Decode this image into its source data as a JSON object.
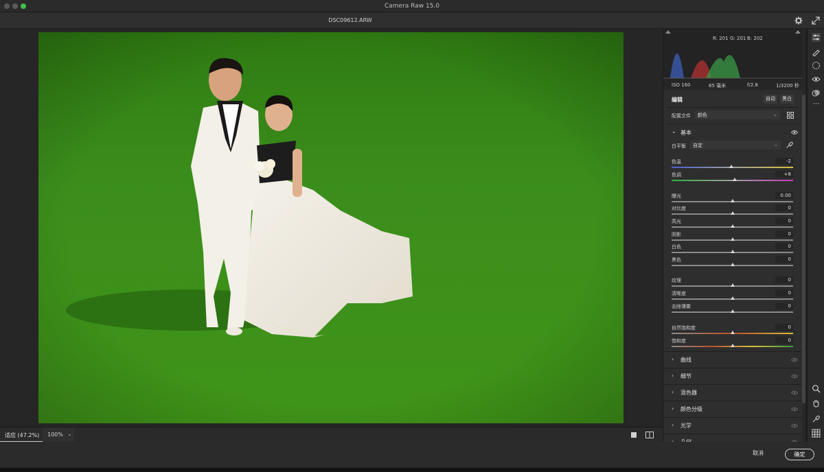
{
  "window": {
    "app_title": "Camera Raw 15.0",
    "file_name": "DSC09612.ARW"
  },
  "histogram": {
    "r_label": "R: 201",
    "g_label": "G: 201",
    "b_label": "B: 202"
  },
  "exif": {
    "iso": "ISO 160",
    "focal": "85 毫米",
    "aperture": "f/2.8",
    "shutter": "1/3200 秒"
  },
  "edit": {
    "title": "编辑",
    "auto_label": "自动",
    "bw_label": "黑白",
    "profile_label": "配置文件",
    "profile_value": "颜色"
  },
  "basic": {
    "title": "基本",
    "wb_label": "白平衡",
    "wb_value": "自定",
    "sliders": [
      {
        "label": "色温",
        "value": "-2",
        "position": 0.49
      },
      {
        "label": "色调",
        "value": "+8",
        "position": 0.52
      },
      {
        "label": "曝光",
        "value": "0.00",
        "position": 0.5
      },
      {
        "label": "对比度",
        "value": "0",
        "position": 0.5
      },
      {
        "label": "高光",
        "value": "0",
        "position": 0.5
      },
      {
        "label": "阴影",
        "value": "0",
        "position": 0.5
      },
      {
        "label": "白色",
        "value": "0",
        "position": 0.5
      },
      {
        "label": "黑色",
        "value": "0",
        "position": 0.5
      },
      {
        "label": "纹理",
        "value": "0",
        "position": 0.5
      },
      {
        "label": "清晰度",
        "value": "0",
        "position": 0.5
      },
      {
        "label": "去除薄雾",
        "value": "0",
        "position": 0.5
      },
      {
        "label": "自然饱和度",
        "value": "0",
        "position": 0.5
      },
      {
        "label": "饱和度",
        "value": "0",
        "position": 0.5
      }
    ]
  },
  "sections": [
    "曲线",
    "细节",
    "混色器",
    "颜色分级",
    "光学",
    "几何"
  ],
  "status": {
    "zoom_fit": "适应 (47.2%)",
    "zoom_100": "100%"
  },
  "footer": {
    "cancel": "取消",
    "ok": "确定"
  },
  "colors": {
    "accent_green": "#3fc04a",
    "panel_bg": "#2e2e2e",
    "grass": "#3e8a1c"
  }
}
